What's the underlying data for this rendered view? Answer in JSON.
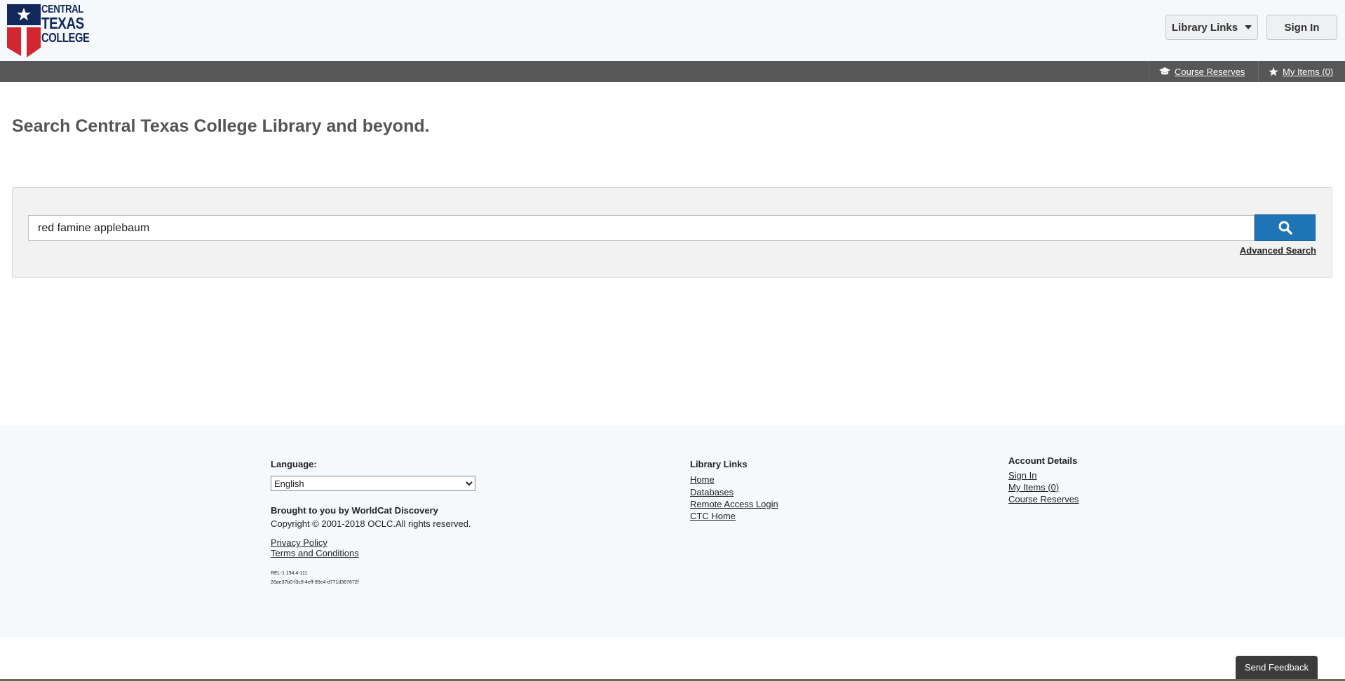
{
  "header": {
    "logo": {
      "line1": "CENTRAL",
      "line2": "TEXAS",
      "line3": "COLLEGE"
    },
    "library_links_label": "Library Links",
    "sign_in_label": "Sign In"
  },
  "navbar": {
    "course_reserves": "Course Reserves",
    "my_items": "My Items (0)"
  },
  "main": {
    "title": "Search Central Texas College Library and beyond.",
    "search_value": "red famine applebaum",
    "advanced_search": "Advanced Search"
  },
  "footer": {
    "language_label": "Language:",
    "language_selected": "English",
    "brought_by": "Brought to you by WorldCat Discovery",
    "copyright": "Copyright © 2001-2018 OCLC.All rights reserved.",
    "privacy": "Privacy Policy",
    "terms": "Terms and Conditions",
    "release": "REL-1.194.4-111",
    "build_id": "26ae37b0-f3c9-4eff-95e4-d771d367672f",
    "library_links": {
      "heading": "Library Links",
      "items": [
        "Home",
        "Databases",
        "Remote Access Login",
        "CTC Home"
      ]
    },
    "account": {
      "heading": "Account Details",
      "items": [
        "Sign In",
        "My Items (0)",
        "Course Reserves"
      ]
    }
  },
  "feedback_label": "Send Feedback",
  "colors": {
    "accent": "#1f74b6",
    "navbar": "#575757",
    "logo_red": "#d22630",
    "logo_navy": "#13285a"
  }
}
